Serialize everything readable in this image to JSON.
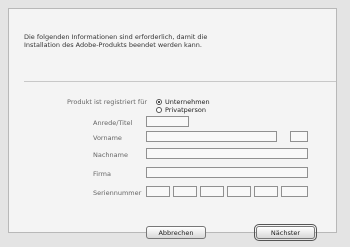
{
  "intro": {
    "line1": "Die folgenden Informationen sind erforderlich, damit die",
    "line2": "Installation des Adobe-Produkts beendet werden kann."
  },
  "registration": {
    "label": "Produkt ist registriert für",
    "options": [
      "Unternehmen",
      "Privatperson"
    ],
    "selected": "Unternehmen"
  },
  "fields": {
    "salutation": {
      "label": "Anrede/Titel",
      "value": ""
    },
    "first_name": {
      "label": "Vorname",
      "value": ""
    },
    "last_name": {
      "label": "Nachname",
      "value": ""
    },
    "company": {
      "label": "Firma",
      "value": ""
    },
    "serial": {
      "label": "Seriennummer",
      "segments": [
        "",
        "",
        "",
        "",
        "",
        ""
      ]
    }
  },
  "buttons": {
    "cancel": "Abbrechen",
    "next": "Nächster"
  }
}
